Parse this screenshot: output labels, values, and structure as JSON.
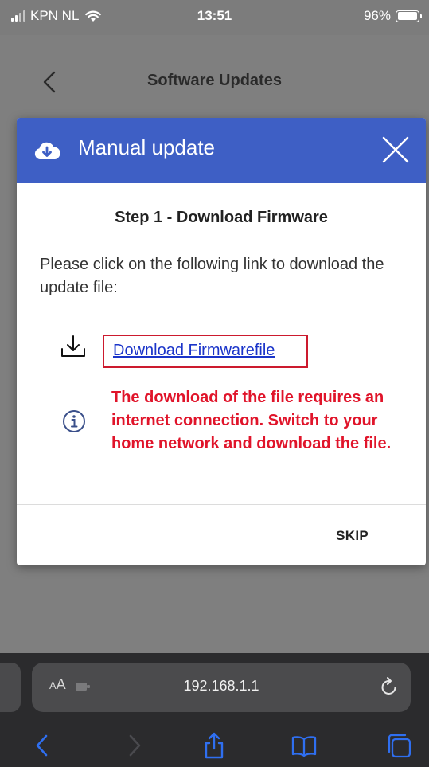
{
  "status_bar": {
    "carrier": "KPN NL",
    "time": "13:51",
    "battery": "96%",
    "battery_level": 0.96
  },
  "page": {
    "title": "Software Updates"
  },
  "modal": {
    "title": "Manual update",
    "step_title": "Step 1 - Download Firmware",
    "instructions": "Please click on the following link to download the update file:",
    "download_link": "Download Firmwarefile",
    "warning": "The download of the file requires an internet connection. Switch to your home network and download the file.",
    "skip_label": "SKIP"
  },
  "browser": {
    "text_size_label_small": "A",
    "text_size_label_large": "A",
    "url": "192.168.1.1"
  },
  "colors": {
    "modal_header": "#3e5fc5",
    "warning_text": "#e0142a",
    "link": "#1a34c9",
    "highlight_box": "#cc1a2e",
    "browser_icons": "#2f6ff0"
  },
  "icons": {
    "header": "cloud-download-icon",
    "close": "close-icon",
    "download": "download-icon",
    "info": "info-icon",
    "reload": "reload-icon",
    "share": "share-icon",
    "bookmarks": "bookmarks-icon",
    "tabs": "tabs-icon"
  }
}
